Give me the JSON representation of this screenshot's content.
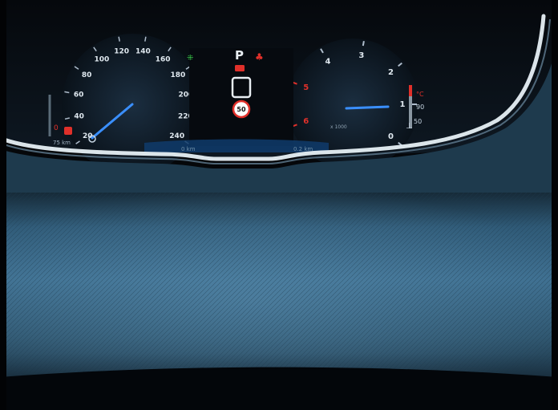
{
  "scene": {
    "description_colors": {
      "dash": "#2f4c61",
      "dash_light": "#4a7191",
      "cluster_bg": "#0b1118",
      "needle": "#3a8fff",
      "accent_red": "#e0302a",
      "accent_green": "#39d04a"
    }
  },
  "speedometer": {
    "ticks": [
      "20",
      "40",
      "60",
      "80",
      "100",
      "120",
      "140",
      "160",
      "180",
      "200",
      "220",
      "240"
    ],
    "current_speed": 0
  },
  "tachometer": {
    "ticks": [
      "0",
      "1",
      "2",
      "3",
      "4",
      "5",
      "6"
    ],
    "red_ticks": [
      "5",
      "6"
    ],
    "unit_label": "x 1000",
    "current_rpm_x1000": 1
  },
  "center": {
    "gear": "P",
    "speed_limit": "50"
  },
  "fuel": {
    "range_label": "75 km",
    "warning": "0"
  },
  "temperature": {
    "high": "90",
    "low": "50"
  },
  "trip": {
    "left": "0 km",
    "right": "0.2 km"
  }
}
